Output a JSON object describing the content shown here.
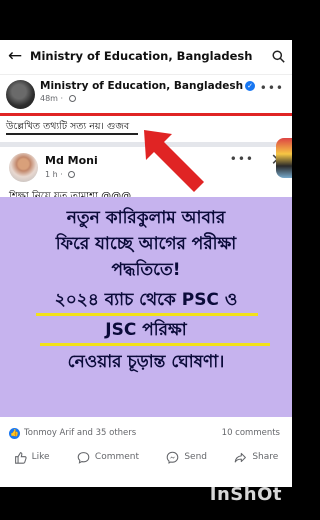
{
  "header": {
    "title": "Ministry of Education, Bangladesh",
    "back_icon": "arrow-left-icon",
    "search_icon": "search-icon"
  },
  "shared_post": {
    "author": "Ministry of Education, Bangladesh",
    "time": "48m",
    "note": "উল্লেখিত তথ্যটি সত্য নয়। গুজব"
  },
  "post": {
    "author": "Md Moni",
    "time": "1 h",
    "caption": "শিক্ষা নিয়ে যত তামাশা @@@",
    "image_lines": [
      "নতুন কারিকুলাম আবার",
      "ফিরে যাচ্ছে আগের পরীক্ষা",
      "পদ্ধতিতে!",
      "২০২৪ ব্যাচ থেকে PSC ও",
      "JSC পরিক্ষা",
      "নেওয়ার চূড়ান্ত ঘোষণা।"
    ],
    "reactions_text": "Tonmoy Arif and 35 others",
    "comments_text": "10 comments"
  },
  "actions": {
    "like": "Like",
    "comment": "Comment",
    "send": "Send",
    "share": "Share"
  },
  "watermark": "InShOt",
  "colors": {
    "accent": "#1877f2",
    "red_line": "#e02424",
    "card_bg": "#c6b3ee",
    "highlight": "#f2e11a"
  }
}
